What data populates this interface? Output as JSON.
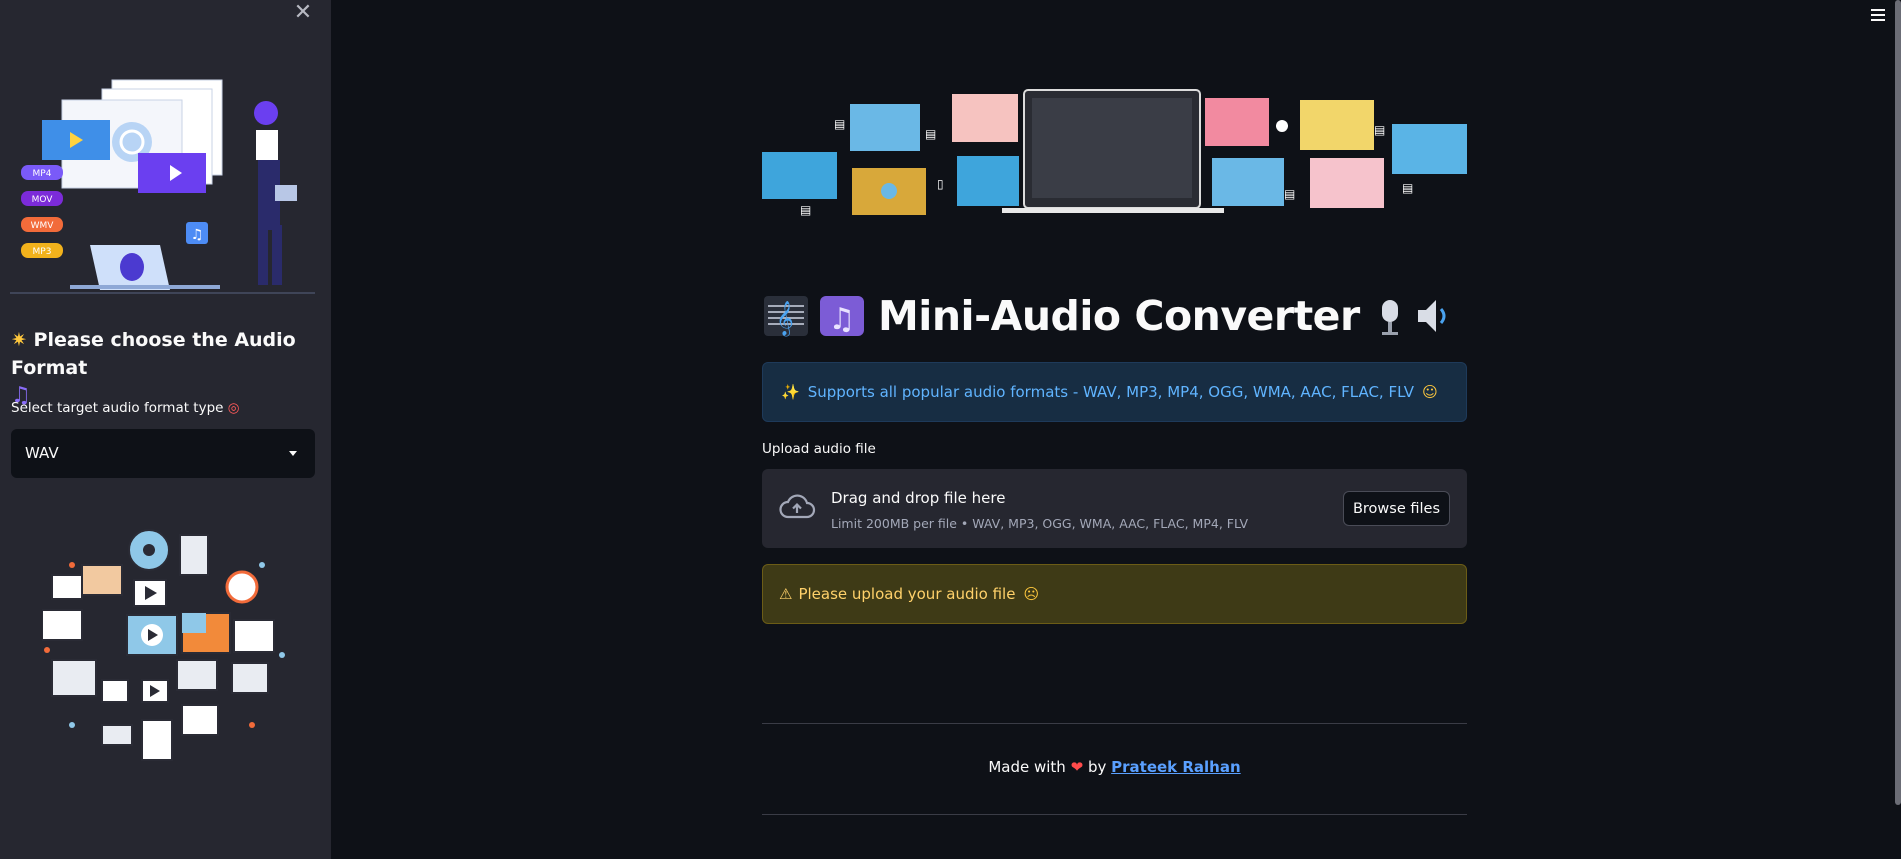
{
  "sidebar": {
    "heading": "Please choose the Audio Format",
    "select_label": "Select target audio format type",
    "select_value": "WAV",
    "format_badges": [
      "MP4",
      "MOV",
      "WMV",
      "MP3"
    ],
    "close_icon": "close-icon"
  },
  "main": {
    "title": "Mini-Audio Converter",
    "info": "Supports all popular audio formats - WAV, MP3, MP4, OGG, WMA, AAC, FLAC, FLV",
    "upload_label": "Upload audio file",
    "dropzone": {
      "title": "Drag and drop file here",
      "limit": "Limit 200MB per file • WAV, MP3, OGG, WMA, AAC, FLAC, MP4, FLV",
      "browse_label": "Browse files"
    },
    "warning": "Please upload your audio file",
    "footer": {
      "made_with": "Made with",
      "by": "by",
      "author": "Prateek Ralhan"
    }
  },
  "colors": {
    "background": "#0e1117",
    "sidebar": "#262730",
    "info_text": "#60b4ff",
    "warning_text": "#ffd16a",
    "link": "#5aa0ff"
  }
}
